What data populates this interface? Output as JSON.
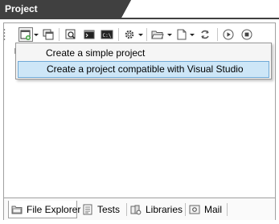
{
  "panel": {
    "title": "Project"
  },
  "toolbar": {
    "buttons": [
      {
        "icon": "new-project-icon",
        "has_dropdown": true,
        "pressed": true
      },
      {
        "icon": "windows-icon"
      },
      {
        "icon": "find-icon"
      },
      {
        "icon": "console-icon"
      },
      {
        "icon": "command-prompt-icon"
      },
      {
        "icon": "gear-icon",
        "has_dropdown": true
      },
      {
        "icon": "open-folder-icon",
        "has_dropdown": true
      },
      {
        "icon": "new-file-icon",
        "has_dropdown": true
      },
      {
        "icon": "refresh-icon"
      },
      {
        "icon": "play-icon"
      },
      {
        "icon": "stop-icon"
      }
    ]
  },
  "menu": {
    "items": [
      {
        "label": "Create a simple project",
        "highlighted": false
      },
      {
        "label": "Create a project compatible with Visual Studio",
        "highlighted": true
      }
    ]
  },
  "tabs": [
    {
      "label": "File Explorer",
      "icon": "file-explorer-icon",
      "active": true
    },
    {
      "label": "Tests",
      "icon": "tests-icon",
      "active": false
    },
    {
      "label": "Libraries",
      "icon": "libraries-icon",
      "active": false
    },
    {
      "label": "Mail",
      "icon": "mail-icon",
      "active": false
    }
  ]
}
